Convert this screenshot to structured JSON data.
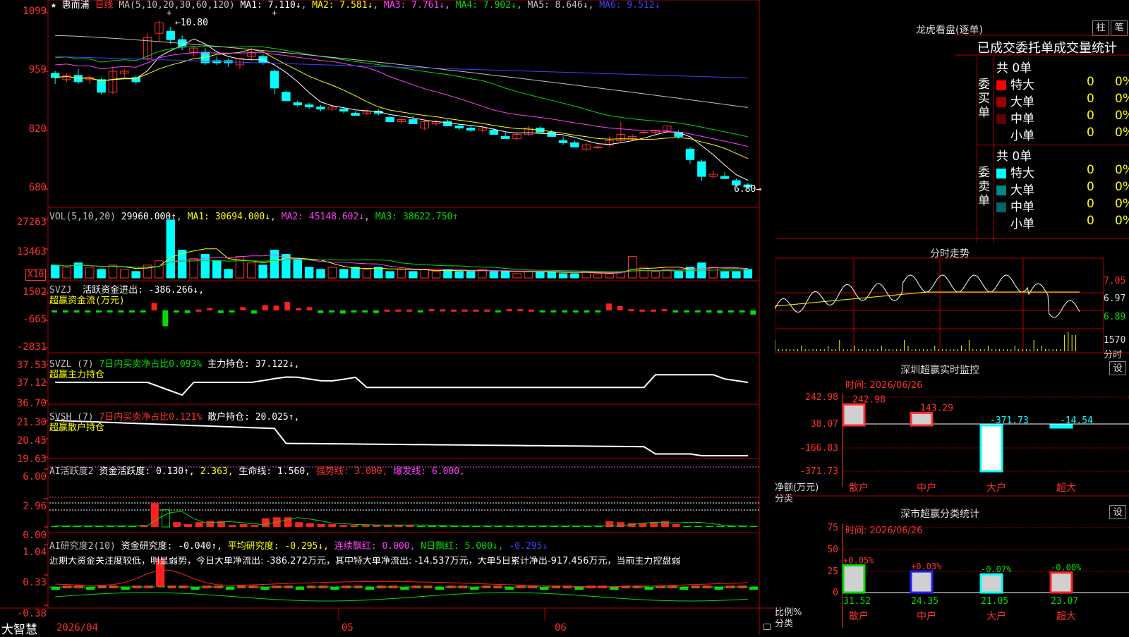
{
  "colors": {
    "up": "#ff3030",
    "down": "#00ffff",
    "ma1": "#ffffff",
    "ma2": "#ffff00",
    "ma3": "#ff40ff",
    "ma4": "#00dd00",
    "ma5": "#c0c0c0",
    "ma6": "#4040ff",
    "grid": "#b00000"
  },
  "kline": {
    "title": "惠而浦",
    "period": "日线",
    "ma_label": "MA(5,10,20,30,60,120)",
    "ma1": "MA1: 7.110↓",
    "ma2": "MA2: 7.581↓",
    "ma3": "MA3: 7.761↓",
    "ma4": "MA4: 7.902↓",
    "ma5": "MA5: 8.646↓",
    "ma6": "MA6: 9.512↓",
    "y_ticks": [
      "1099",
      "959",
      "820",
      "680"
    ],
    "high_label": "←10.80",
    "low_label": "6.80→",
    "ohlc": [
      [
        9.55,
        9.6,
        9.3,
        9.45
      ],
      [
        9.4,
        9.55,
        9.35,
        9.5
      ],
      [
        9.5,
        9.65,
        9.3,
        9.35
      ],
      [
        9.4,
        9.5,
        9.3,
        9.45
      ],
      [
        9.4,
        9.45,
        9.05,
        9.1
      ],
      [
        9.1,
        9.7,
        9.05,
        9.6
      ],
      [
        9.55,
        9.65,
        9.45,
        9.6
      ],
      [
        9.45,
        9.5,
        9.3,
        9.35
      ],
      [
        9.9,
        10.5,
        9.85,
        10.4
      ],
      [
        10.5,
        10.8,
        10.3,
        10.75
      ],
      [
        10.55,
        10.65,
        10.25,
        10.35
      ],
      [
        10.35,
        10.45,
        10.1,
        10.2
      ],
      [
        10.05,
        10.2,
        9.95,
        10.15
      ],
      [
        10.05,
        10.15,
        9.75,
        9.8
      ],
      [
        9.85,
        9.95,
        9.75,
        9.8
      ],
      [
        9.85,
        9.9,
        9.7,
        9.8
      ],
      [
        9.75,
        9.9,
        9.65,
        9.9
      ],
      [
        9.95,
        10.15,
        9.85,
        10.05
      ],
      [
        9.95,
        10.0,
        9.75,
        9.8
      ],
      [
        9.6,
        9.65,
        9.05,
        9.2
      ],
      [
        9.1,
        9.15,
        8.9,
        8.9
      ],
      [
        8.85,
        8.9,
        8.75,
        8.8
      ],
      [
        8.8,
        8.85,
        8.7,
        8.75
      ],
      [
        8.75,
        8.8,
        8.65,
        8.7
      ],
      [
        8.7,
        8.8,
        8.65,
        8.75
      ],
      [
        8.7,
        8.75,
        8.6,
        8.65
      ],
      [
        8.6,
        8.65,
        8.55,
        8.55
      ],
      [
        8.6,
        8.7,
        8.55,
        8.65
      ],
      [
        8.65,
        8.7,
        8.55,
        8.6
      ],
      [
        8.5,
        8.55,
        8.4,
        8.4
      ],
      [
        8.4,
        8.5,
        8.35,
        8.45
      ],
      [
        8.45,
        8.55,
        8.35,
        8.35
      ],
      [
        8.25,
        8.45,
        8.2,
        8.4
      ],
      [
        8.35,
        8.45,
        8.3,
        8.4
      ],
      [
        8.4,
        8.45,
        8.3,
        8.3
      ],
      [
        8.3,
        8.35,
        8.2,
        8.25
      ],
      [
        8.25,
        8.3,
        8.15,
        8.2
      ],
      [
        8.2,
        8.3,
        8.15,
        8.25
      ],
      [
        8.2,
        8.25,
        8.1,
        8.1
      ],
      [
        8.05,
        8.15,
        8.0,
        8.0
      ],
      [
        8.0,
        8.15,
        7.95,
        8.1
      ],
      [
        8.1,
        8.3,
        8.05,
        8.25
      ],
      [
        8.25,
        8.3,
        8.15,
        8.15
      ],
      [
        8.15,
        8.2,
        8.05,
        8.05
      ],
      [
        7.95,
        8.05,
        7.85,
        7.9
      ],
      [
        7.9,
        7.95,
        7.8,
        7.8
      ],
      [
        7.75,
        7.9,
        7.7,
        7.85
      ],
      [
        7.8,
        7.85,
        7.75,
        7.8
      ],
      [
        7.85,
        8.05,
        7.8,
        7.95
      ],
      [
        7.95,
        8.4,
        7.9,
        8.1
      ],
      [
        8.0,
        8.1,
        7.95,
        8.05
      ],
      [
        8.15,
        8.2,
        8.1,
        8.15
      ],
      [
        8.15,
        8.2,
        8.1,
        8.2
      ],
      [
        8.2,
        8.3,
        8.15,
        8.3
      ],
      [
        8.15,
        8.2,
        8.0,
        8.05
      ],
      [
        7.75,
        7.8,
        7.4,
        7.5
      ],
      [
        7.45,
        7.5,
        7.0,
        7.1
      ],
      [
        7.1,
        7.25,
        7.05,
        7.15
      ],
      [
        7.1,
        7.2,
        7.05,
        7.05
      ],
      [
        7.0,
        7.05,
        6.85,
        6.9
      ],
      [
        6.9,
        6.95,
        6.8,
        6.85
      ]
    ]
  },
  "vol": {
    "label": "VOL(5,10,20)",
    "value": "29960.000↑",
    "ma1": "MA1: 30694.000↓",
    "ma2": "MA2: 45148.602↓",
    "ma3": "MA3: 38622.750↑",
    "y_ticks": [
      "27263",
      "13463"
    ],
    "unit": "X10",
    "values": [
      6,
      5,
      7,
      5,
      4,
      6,
      4,
      3,
      6,
      8,
      27,
      13,
      9,
      11,
      8,
      4,
      10,
      7,
      6,
      13,
      11,
      9,
      5,
      4,
      5,
      4,
      5,
      4,
      5,
      3,
      4,
      3,
      4,
      3,
      4,
      3,
      3,
      4,
      3,
      3,
      2,
      3,
      3,
      3,
      2,
      2,
      3,
      2,
      2,
      3,
      10,
      5,
      3,
      4,
      3,
      5,
      7,
      5,
      3,
      3,
      4
    ]
  },
  "svzj": {
    "label": "SVZJ",
    "desc": "活跃资金进出: -386.266↓,",
    "sub": "超赢资金流(万元)",
    "y_ticks": [
      "1502",
      "-665",
      "-2831"
    ],
    "values": [
      -80,
      -80,
      -80,
      -80,
      -80,
      -80,
      -80,
      -80,
      -200,
      700,
      -1500,
      -150,
      -250,
      80,
      200,
      -250,
      -200,
      300,
      -300,
      500,
      450,
      800,
      200,
      300,
      -250,
      -180,
      -300,
      -150,
      -120,
      -250,
      80,
      80,
      80,
      -100,
      120,
      100,
      80,
      80,
      80,
      80,
      -100,
      120,
      120,
      80,
      -80,
      -80,
      -80,
      -80,
      -80,
      -80,
      650,
      400,
      120,
      80,
      80,
      120,
      -200,
      -100,
      -200,
      -150,
      -250,
      -80,
      -80,
      -400
    ]
  },
  "svzl": {
    "label": "SVZL (7)",
    "desc1": "7日内买卖净占比0.093%",
    "desc2": "主力持仓: 37.122↓,",
    "sub": "超赢主力持仓",
    "y_ticks": [
      "37.53",
      "37.12",
      "36.70"
    ]
  },
  "svsh": {
    "label": "SVSH (7)",
    "desc1": "7日内买卖净占比0.121%",
    "desc2": "散户持仓: 20.025↑,",
    "sub": "超赢散户持仓",
    "y_ticks": [
      "21.30",
      "20.45",
      "19.63"
    ]
  },
  "ai1": {
    "label": "AI活跃度2",
    "desc": "资金活跃度: 0.130↑,",
    "v2": "2.363,",
    "life": "生命线: 1.560,",
    "strong": "强势线: 3.000,",
    "burst": "爆发线: 6.000,",
    "y_ticks": [
      "6.00",
      "2.96",
      "0.00"
    ],
    "values": [
      0.1,
      0.1,
      0.1,
      0.1,
      0.1,
      0.1,
      0.1,
      0.1,
      0.2,
      2.5,
      1.8,
      0.5,
      0.3,
      0.5,
      0.6,
      0.6,
      0.2,
      0.3,
      0.2,
      0.9,
      1.0,
      1.0,
      0.5,
      0.4,
      0.3,
      0.3,
      0.2,
      0.2,
      0.2,
      0.2,
      0.2,
      0.2,
      0.2,
      0.1,
      0.1,
      0.1,
      0.1,
      0.1,
      0.1,
      0.1,
      0.1,
      0.1,
      0.1,
      0.1,
      0.1,
      0.1,
      0.1,
      0.1,
      0.1,
      0.1,
      0.6,
      0.5,
      0.4,
      0.4,
      0.5,
      0.6,
      0.3,
      0.1,
      0.1,
      0.1,
      0.1,
      0.1,
      0.1,
      0.1
    ]
  },
  "ai2": {
    "label": "AI研究度2(10)",
    "desc": "资金研究度: -0.040↑,",
    "avg": "平均研究度: -0.295↓,",
    "red": "连续飘红: 0.000,",
    "nred": "N日飘红: 5.000↓,",
    "last": "-0.295↓",
    "text": "近期大资金关注度较低，明显弱势，今日大单净流出: -386.272万元，其中特大单净流出: -14.537万元，大单5日累计净出-917.456万元，当前主力控盘弱",
    "y_ticks": [
      "1.04",
      "0.33",
      "-0.38"
    ]
  },
  "footer": {
    "brand": "大智慧",
    "dates": [
      "2026/04",
      "05",
      "06"
    ]
  },
  "right": {
    "dragon": {
      "title": "龙虎看盘(逐单)",
      "btn1": "柱",
      "btn2": "笔",
      "tabs": "已成交委托单成交量统计",
      "buy_label": "委买单",
      "sell_label": "委卖单",
      "buy_total": "共 0单",
      "sell_total": "共 0单",
      "buy_rows": [
        {
          "name": "特大",
          "n": "0",
          "p": "0%",
          "color": "#ff0000"
        },
        {
          "name": "大单",
          "n": "0",
          "p": "0%",
          "color": "#a00000"
        },
        {
          "name": "中单",
          "n": "0",
          "p": "0%",
          "color": "#600000"
        },
        {
          "name": "小单",
          "n": "0",
          "p": "0%",
          "color": "#000000"
        }
      ],
      "sell_rows": [
        {
          "name": "特大",
          "n": "0",
          "p": "0%",
          "color": "#00ffff"
        },
        {
          "name": "大单",
          "n": "0",
          "p": "0%",
          "color": "#008888"
        },
        {
          "name": "中单",
          "n": "0",
          "p": "0%",
          "color": "#006666"
        },
        {
          "name": "小单",
          "n": "0",
          "p": "0%",
          "color": "#000000"
        }
      ]
    },
    "timeline": {
      "title": "分时走势",
      "y_ticks": [
        "7.05",
        "6.97",
        "6.89"
      ],
      "vol_label": "1570",
      "vol_unit": "分时"
    },
    "monitor": {
      "title": "深圳超赢实时监控",
      "btn": "设",
      "time": "时间: 2026/06/26",
      "y_ticks": [
        "242.98",
        "38.07",
        "-166.83",
        "-371.73"
      ],
      "axis_label": "净额(万元)",
      "axis_sub": "分类",
      "bars": [
        {
          "name": "散户",
          "value": 242.98,
          "label": "242.98"
        },
        {
          "name": "中户",
          "value": 143.29,
          "label": "143.29"
        },
        {
          "name": "大户",
          "value": -371.73,
          "label": "-371.73"
        },
        {
          "name": "超大",
          "value": -14.54,
          "label": "-14.54"
        }
      ]
    },
    "category": {
      "title": "深市超赢分类统计",
      "btn": "设",
      "time": "时间: 2026/06/26",
      "y_ticks": [
        "75",
        "50",
        "25",
        "0"
      ],
      "axis_label": "比例%",
      "axis_sub": "分类",
      "bars": [
        {
          "name": "散户",
          "value": 31.52,
          "label": "31.52",
          "change": "+0.05%"
        },
        {
          "name": "中户",
          "value": 24.35,
          "label": "24.35",
          "change": "+0.03%"
        },
        {
          "name": "大户",
          "value": 21.05,
          "label": "21.05",
          "change": "-0.07%"
        },
        {
          "name": "超大",
          "value": 23.07,
          "label": "23.07",
          "change": "-0.00%"
        }
      ]
    }
  }
}
